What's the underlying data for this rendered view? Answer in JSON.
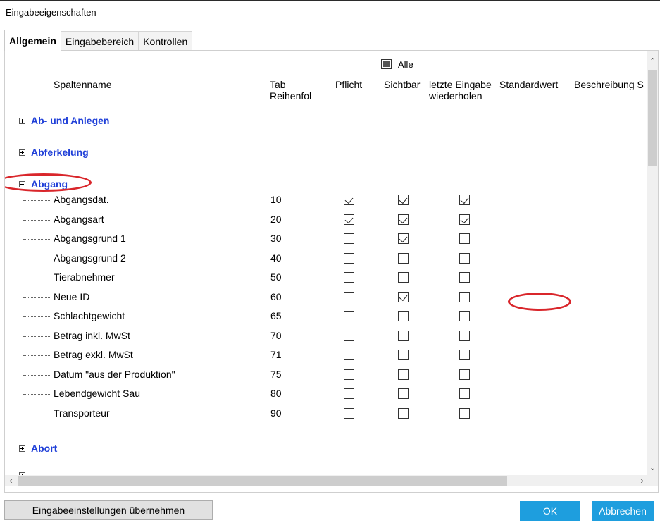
{
  "window": {
    "title": "Eingabeeigenschaften"
  },
  "tabs": [
    {
      "label": "Allgemein",
      "active": true
    },
    {
      "label": "Eingabebereich",
      "active": false
    },
    {
      "label": "Kontrollen",
      "active": false
    }
  ],
  "toolbar": {
    "alle_label": "Alle"
  },
  "columns": {
    "spaltenname": "Spaltenname",
    "tab_line1": "Tab",
    "tab_line2": "Reihenfol",
    "pflicht": "Pflicht",
    "sichtbar": "Sichtbar",
    "letzte_line1": "letzte Eingabe",
    "letzte_line2": "wiederholen",
    "standardwert": "Standardwert",
    "beschreibung": "Beschreibung S"
  },
  "groups": [
    {
      "label": "Ab- und Anlegen",
      "expanded": false
    },
    {
      "label": "Abferkelung",
      "expanded": false
    },
    {
      "label": "Abgang",
      "expanded": true
    },
    {
      "label": "Abort",
      "expanded": false
    }
  ],
  "rows": [
    {
      "name": "Abgangsdat.",
      "order": "10",
      "pflicht": true,
      "sichtbar": true,
      "letzte": true
    },
    {
      "name": "Abgangsart",
      "order": "20",
      "pflicht": true,
      "sichtbar": true,
      "letzte": true
    },
    {
      "name": "Abgangsgrund 1",
      "order": "30",
      "pflicht": false,
      "sichtbar": true,
      "letzte": false
    },
    {
      "name": "Abgangsgrund 2",
      "order": "40",
      "pflicht": false,
      "sichtbar": false,
      "letzte": false
    },
    {
      "name": "Tierabnehmer",
      "order": "50",
      "pflicht": false,
      "sichtbar": false,
      "letzte": false
    },
    {
      "name": "Neue ID",
      "order": "60",
      "pflicht": false,
      "sichtbar": true,
      "letzte": false
    },
    {
      "name": "Schlachtgewicht",
      "order": "65",
      "pflicht": false,
      "sichtbar": false,
      "letzte": false
    },
    {
      "name": "Betrag inkl. MwSt",
      "order": "70",
      "pflicht": false,
      "sichtbar": false,
      "letzte": false
    },
    {
      "name": "Betrag exkl. MwSt",
      "order": "71",
      "pflicht": false,
      "sichtbar": false,
      "letzte": false
    },
    {
      "name": "Datum \"aus der Produktion\"",
      "order": "75",
      "pflicht": false,
      "sichtbar": false,
      "letzte": false
    },
    {
      "name": "Lebendgewicht Sau",
      "order": "80",
      "pflicht": false,
      "sichtbar": false,
      "letzte": false
    },
    {
      "name": "Transporteur",
      "order": "90",
      "pflicht": false,
      "sichtbar": false,
      "letzte": false
    }
  ],
  "buttons": {
    "apply": "Eingabeeinstellungen übernehmen",
    "ok": "OK",
    "cancel": "Abbrechen"
  },
  "colors": {
    "accent": "#1e9ede",
    "group_link": "#1f3fd8",
    "marker": "#d9262b"
  }
}
